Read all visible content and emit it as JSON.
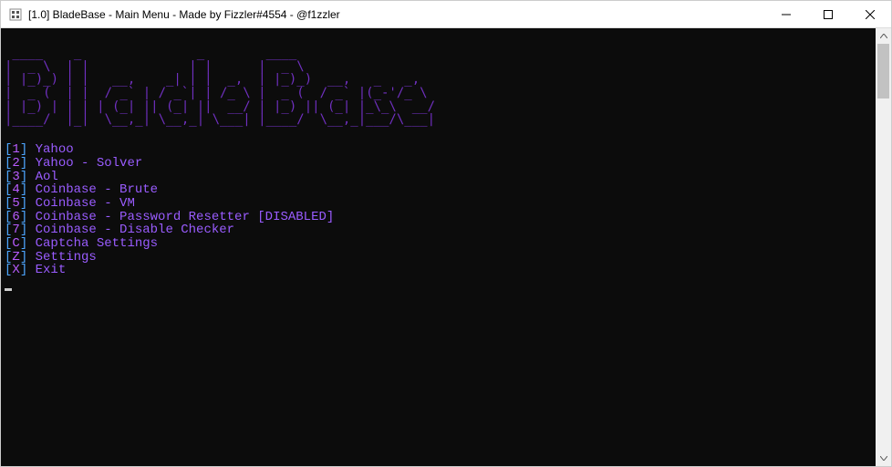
{
  "window": {
    "title": "[1.0] BladeBase - Main Menu - Made by Fizzler#4554 - @f1zzler"
  },
  "ascii_art": " ____,  __,             __,         ____,                       \n(-|__) (-|    _,    _| (-/_,       (-|__)  _,   _   _, \n _|__)  _|__ (_|_  (_|  _|__,       _|__) (_|_,_/_)_|__,\n(      (                          (                    ",
  "menu": [
    {
      "key": "1",
      "label": "Yahoo"
    },
    {
      "key": "2",
      "label": "Yahoo - Solver"
    },
    {
      "key": "3",
      "label": "Aol"
    },
    {
      "key": "4",
      "label": "Coinbase - Brute"
    },
    {
      "key": "5",
      "label": "Coinbase - VM"
    },
    {
      "key": "6",
      "label": "Coinbase - Password Resetter [DISABLED]"
    },
    {
      "key": "7",
      "label": "Coinbase - Disable Checker"
    },
    {
      "key": "C",
      "label": "Captcha Settings"
    },
    {
      "key": "Z",
      "label": "Settings"
    },
    {
      "key": "X",
      "label": "Exit"
    }
  ],
  "colors": {
    "bracket": "#4da6ff",
    "key": "#b85cff",
    "label": "#9a5cff",
    "ascii": "#7030c0",
    "console_bg": "#0c0c0c"
  }
}
